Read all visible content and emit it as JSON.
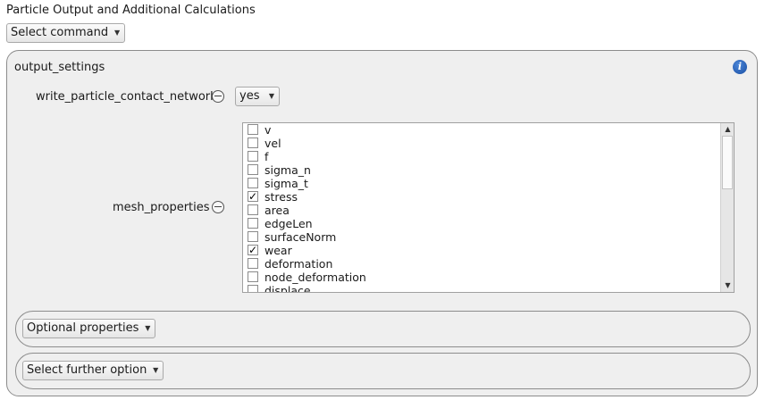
{
  "page": {
    "title": "Particle Output and Additional Calculations"
  },
  "command_select": {
    "label": "Select command"
  },
  "output_settings": {
    "title": "output_settings",
    "info_icon": "info-icon",
    "write_particle_contact_network": {
      "label": "write_particle_contact_network",
      "value": "yes"
    },
    "mesh_properties": {
      "label": "mesh_properties",
      "items": [
        {
          "label": "v",
          "checked": false
        },
        {
          "label": "vel",
          "checked": false
        },
        {
          "label": "f",
          "checked": false
        },
        {
          "label": "sigma_n",
          "checked": false
        },
        {
          "label": "sigma_t",
          "checked": false
        },
        {
          "label": "stress",
          "checked": true
        },
        {
          "label": "area",
          "checked": false
        },
        {
          "label": "edgeLen",
          "checked": false
        },
        {
          "label": "surfaceNorm",
          "checked": false
        },
        {
          "label": "wear",
          "checked": true
        },
        {
          "label": "deformation",
          "checked": false
        },
        {
          "label": "node_deformation",
          "checked": false
        },
        {
          "label": "displace",
          "checked": false
        }
      ]
    }
  },
  "optional_properties": {
    "label": "Optional properties"
  },
  "further_option": {
    "label": "Select further option"
  },
  "colors": {
    "panel_bg": "#efefef",
    "panel_border": "#8c8c8c",
    "info_blue": "#1a4fa3"
  }
}
